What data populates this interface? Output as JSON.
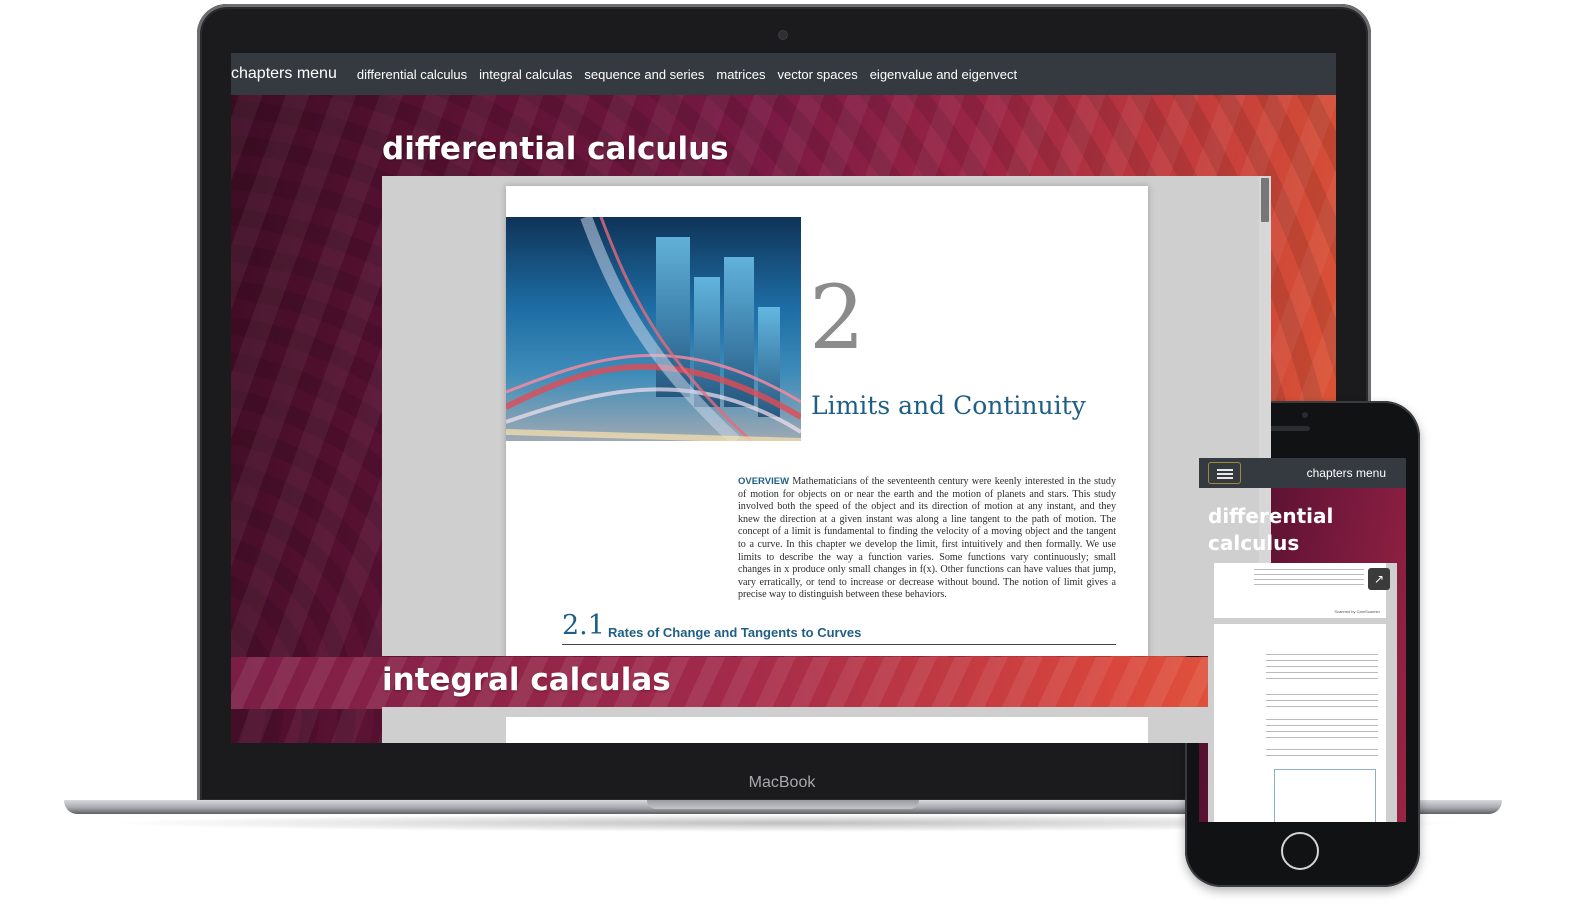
{
  "laptop": {
    "brand_label": "MacBook",
    "navbar": {
      "brand": "chapters menu",
      "links": [
        "differential calculus",
        "integral calculas",
        "sequence and series",
        "matrices",
        "vector spaces",
        "eigenvalue and eigenvect"
      ]
    },
    "sections": [
      {
        "title": "differential calculus"
      },
      {
        "title": "integral calculas"
      }
    ],
    "document": {
      "chapter_number": "2",
      "chapter_title": "Limits and Continuity",
      "overview_label": "OVERVIEW",
      "overview_text": "Mathematicians of the seventeenth century were keenly interested in the study of motion for objects on or near the earth and the motion of planets and stars. This study involved both the speed of the object and its direction of motion at any instant, and they knew the direction at a given instant was along a line tangent to the path of motion. The concept of a limit is fundamental to finding the velocity of a moving object and the tangent to a curve. In this chapter we develop the limit, first intuitively and then formally. We use limits to describe the way a function varies. Some functions vary continuously; small changes in x produce only small changes in f(x). Other functions can have values that jump, vary erratically, or tend to increase or decrease without bound. The notion of limit gives a precise way to distinguish between these behaviors.",
      "section_number": "2.1",
      "section_title": "Rates of Change and Tangents to Curves"
    }
  },
  "phone": {
    "navbar": {
      "brand": "chapters menu"
    },
    "section_title": "differential calculus",
    "open_icon": "external-link-icon",
    "menu_icon": "hamburger-menu-icon",
    "footer_text": "Scanned by CamScanner"
  },
  "colors": {
    "navbar_bg": "#343a40",
    "accent_blue": "#1f5f86",
    "gradient_start": "#3c0c24",
    "gradient_end": "#e25a33"
  }
}
